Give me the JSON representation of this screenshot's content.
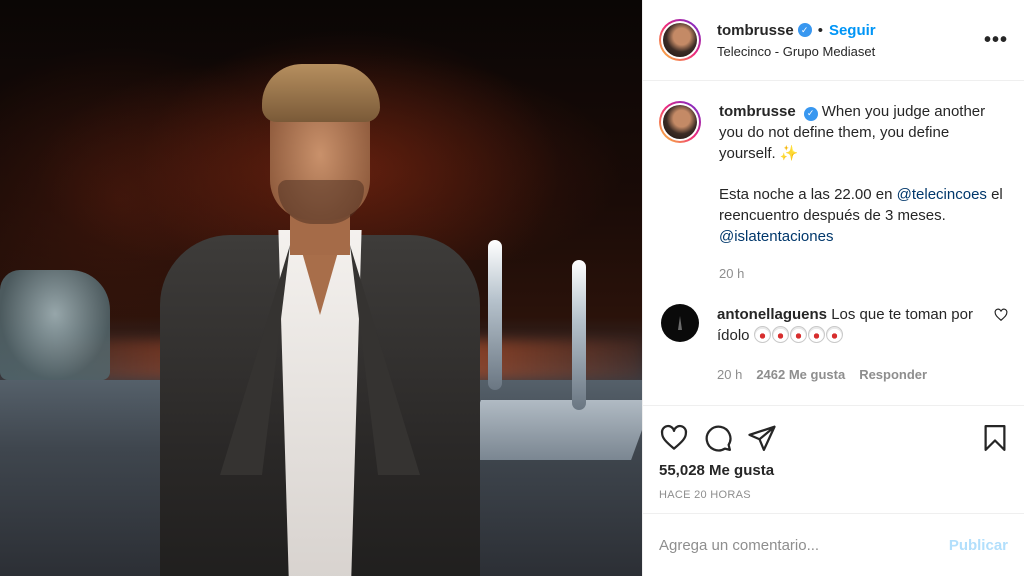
{
  "post": {
    "author": {
      "username": "tombrusse",
      "verified": true,
      "follow_label": "Seguir",
      "separator": "•",
      "location": "Telecinco - Grupo Mediaset"
    },
    "more_icon": "more-horizontal-icon",
    "more_label": "•••",
    "caption": {
      "username": "tombrusse",
      "text_line1": "When you judge another you do not define them, you define yourself.",
      "sparkle": "✨",
      "para2_prefix": "Esta noche a las 22.00 en ",
      "mention1": "@telecincoes",
      "para2_mid": " el reencuentro después de 3 meses. ",
      "mention2": "@islatentaciones",
      "time": "20 h"
    },
    "comments": [
      {
        "username": "antonellaguens",
        "text": "Los que te toman por ídolo",
        "emoji_name": "clown-face",
        "emoji_count": 5,
        "time": "20 h",
        "likes": "2462 Me gusta",
        "reply": "Responder"
      }
    ],
    "actions": {
      "like_icon": "heart-icon",
      "comment_icon": "comment-icon",
      "share_icon": "paper-plane-icon",
      "save_icon": "bookmark-icon"
    },
    "likes_label": "55,028 Me gusta",
    "posted_ago": "HACE 20 HORAS",
    "add_comment": {
      "placeholder": "Agrega un comentario...",
      "publish_label": "Publicar"
    },
    "colors": {
      "link": "#0095f6",
      "mention": "#00376b",
      "muted": "#8e8e8e",
      "publish_disabled": "#b2dffc"
    }
  }
}
